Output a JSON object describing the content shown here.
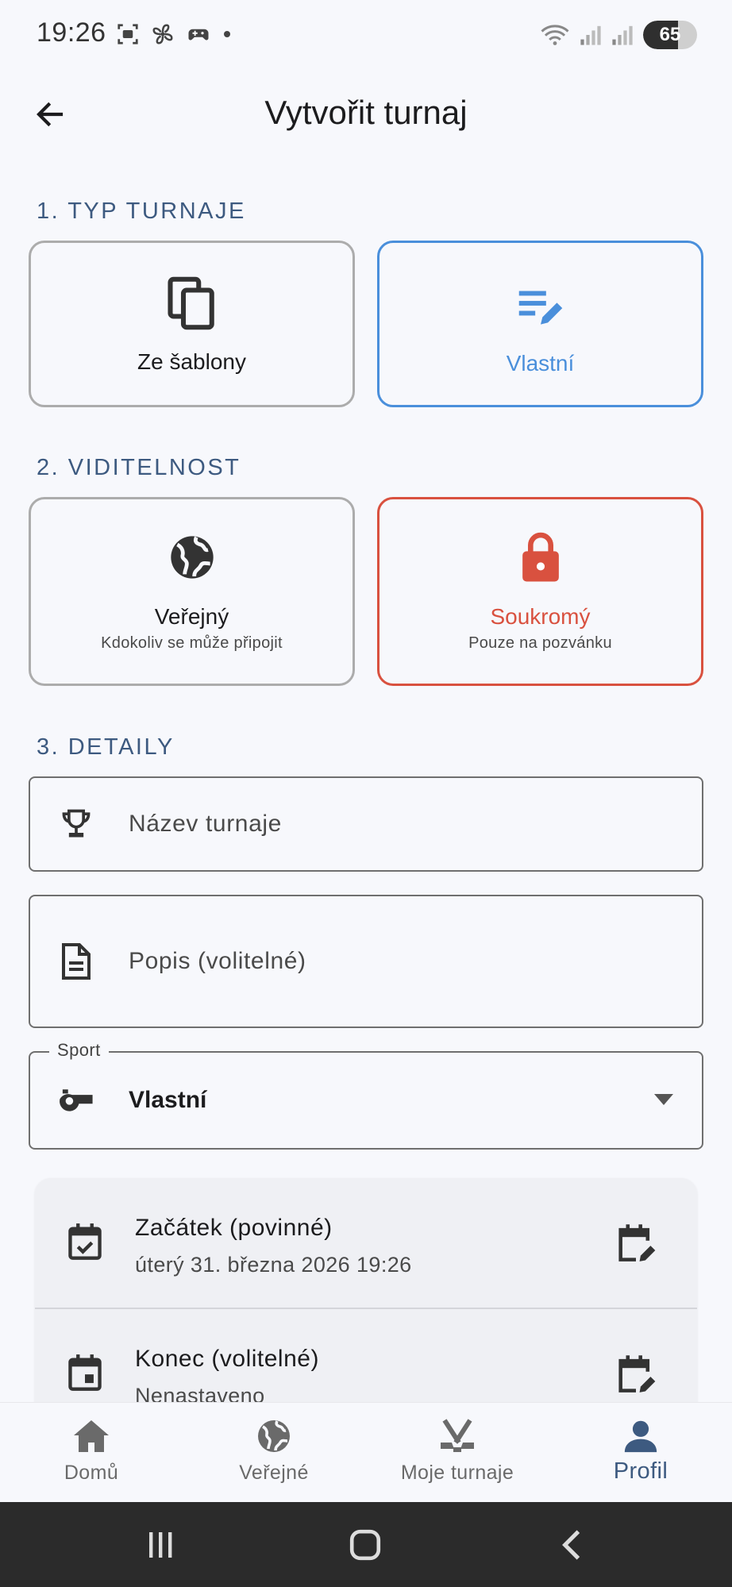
{
  "status_bar": {
    "time": "19:26",
    "battery": "65",
    "battery_level": 65
  },
  "header": {
    "title": "Vytvořit turnaj",
    "back_icon": "arrow-back-icon"
  },
  "type_section": {
    "header": "1. TYP TURNAJE",
    "options": [
      {
        "label": "Ze šablony",
        "icon": "copy-icon",
        "selected": false
      },
      {
        "label": "Vlastní",
        "icon": "edit-note-icon",
        "selected": true
      }
    ]
  },
  "visibility_section": {
    "header": "2. VIDITELNOST",
    "options": [
      {
        "label": "Veřejný",
        "subtitle": "Kdokoliv se může připojit",
        "icon": "globe-icon",
        "selected": false
      },
      {
        "label": "Soukromý",
        "subtitle": "Pouze na pozvánku",
        "icon": "lock-icon",
        "selected": true
      }
    ]
  },
  "details_section": {
    "header": "3. DETAILY",
    "name_field": {
      "placeholder": "Název turnaje",
      "icon": "trophy-icon"
    },
    "description_field": {
      "placeholder": "Popis (volitelné)",
      "icon": "document-icon"
    },
    "sport_select": {
      "label": "Sport",
      "value": "Vlastní",
      "icon": "whistle-icon"
    }
  },
  "dates": {
    "start": {
      "title": "Začátek (povinné)",
      "value": "úterý 31. března 2026 19:26",
      "icon": "event-available-icon",
      "action_icon": "edit-calendar-icon"
    },
    "end": {
      "title": "Konec (volitelné)",
      "value": "Nenastaveno",
      "icon": "event-icon",
      "action_icon": "edit-calendar-icon"
    }
  },
  "colors": {
    "accent_blue": "#4a8fdb",
    "accent_red": "#d9513f",
    "section_header": "#3d5a80"
  },
  "bottom_nav": {
    "items": [
      {
        "label": "Domů",
        "icon": "home-icon",
        "active": false
      },
      {
        "label": "Veřejné",
        "icon": "globe-icon",
        "active": false
      },
      {
        "label": "Moje turnaje",
        "icon": "hockey-sticks-icon",
        "active": false
      },
      {
        "label": "Profil",
        "icon": "person-icon",
        "active": true
      }
    ]
  }
}
